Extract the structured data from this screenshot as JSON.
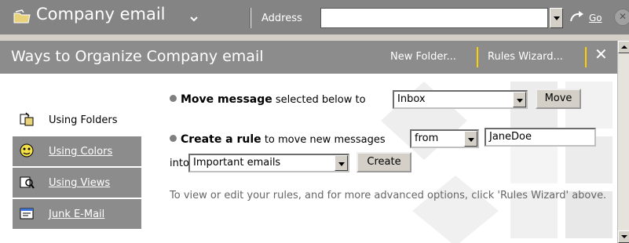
{
  "toolbar": {
    "folder_title": "Company email",
    "address_label": "Address",
    "go_label": "Go"
  },
  "header": {
    "title": "Ways to Organize Company email",
    "new_folder": "New Folder...",
    "rules_wizard": "Rules Wizard...",
    "close": "✕"
  },
  "tabs": [
    {
      "label": "Using Folders",
      "icon": "folders-icon",
      "active": true
    },
    {
      "label": "Using Colors",
      "icon": "colors-icon",
      "active": false
    },
    {
      "label": "Using Views",
      "icon": "views-icon",
      "active": false
    },
    {
      "label": "Junk E-Mail",
      "icon": "junk-mail-icon",
      "active": false
    }
  ],
  "move": {
    "bold_text": "Move message",
    "rest_text": "selected below to",
    "folder_value": "Inbox",
    "button": "Move"
  },
  "rule": {
    "bold_text": "Create a rule",
    "rest_text": "to move new messages",
    "condition_value": "from",
    "sender_value": "JaneDoe",
    "into_label": "into",
    "target_value": "Important emails",
    "button": "Create"
  },
  "info_text": "To view or edit your rules, and for more advanced options, click 'Rules Wizard' above.",
  "colors": {
    "toolbar_bg": "#848484",
    "header_bg": "#8c8c8c",
    "separator": "#ffd000",
    "panel_bg": "#ffffff"
  }
}
